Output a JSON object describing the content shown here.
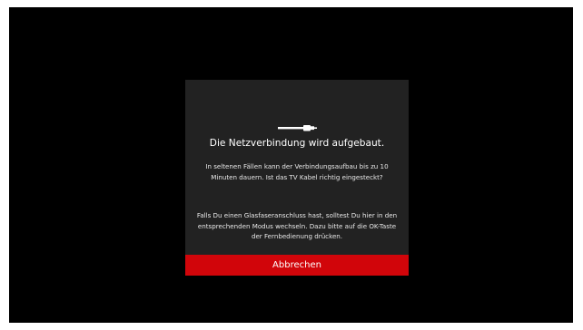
{
  "dialog": {
    "icon": "network-cable-icon",
    "title": "Die Netzverbindung wird aufgebaut.",
    "body_1": "In seltenen Fällen kann der Verbindungsaufbau bis zu 10 Minuten dauern. Ist das TV Kabel richtig eingesteckt?",
    "body_2": "Falls Du einen Glasfaseranschluss hast, solltest Du hier in den entsprechenden Modus wechseln. Dazu bitte auf die OK-Taste der Fernbedienung drücken.",
    "cancel_label": "Abbrechen"
  },
  "colors": {
    "screen_background": "#000000",
    "dialog_background": "#222222",
    "accent": "#d1050a",
    "text": "#ffffff"
  }
}
